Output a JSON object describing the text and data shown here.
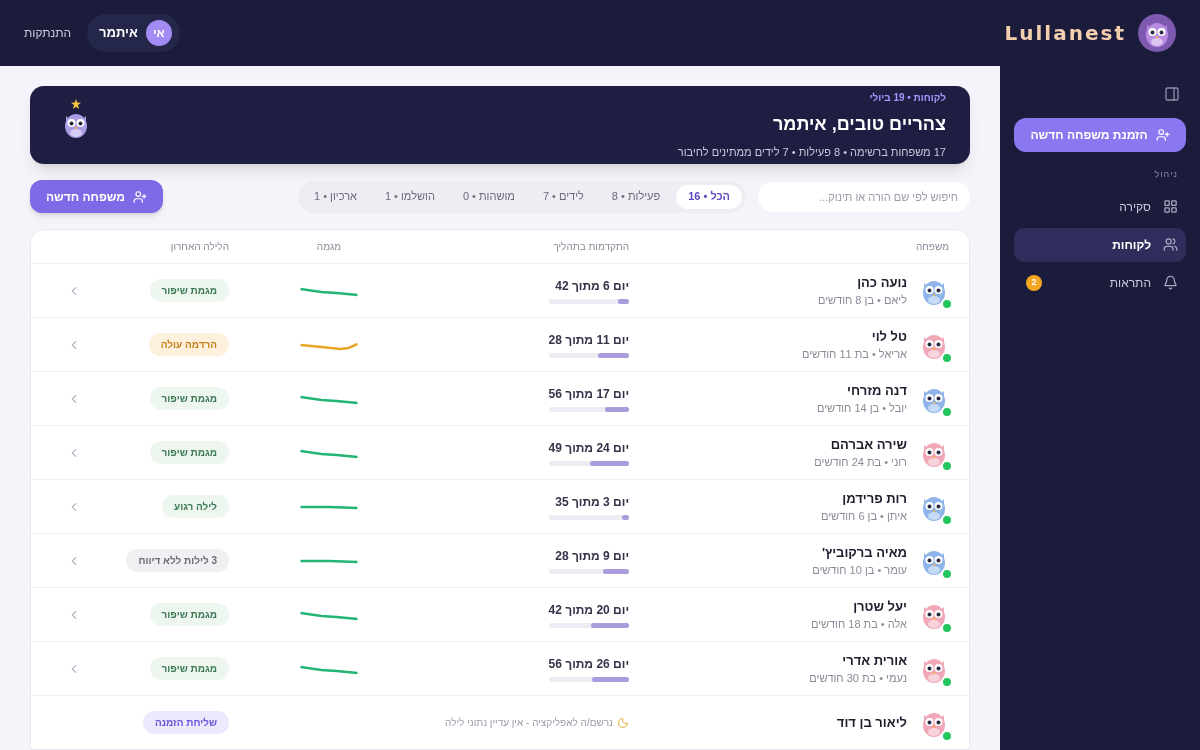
{
  "header": {
    "brand": "Lullanest",
    "user": {
      "initials": "אי",
      "name": "איתמר"
    },
    "logout": "התנתקות"
  },
  "sidebar": {
    "invite_button": "הזמנת משפחה חדשה",
    "section": "ניהול",
    "items": [
      {
        "label": "סקירה",
        "selected": false
      },
      {
        "label": "לקוחות",
        "selected": true
      },
      {
        "label": "התראות",
        "selected": false,
        "badge": "2"
      }
    ]
  },
  "hero": {
    "eyebrow": "לקוחות • 19 ביולי",
    "title": "צהריים טובים, איתמר",
    "subtitle": "17 משפחות ברשימה • 8 פעילות • 7 לידים ממתינים לחיבור"
  },
  "search": {
    "placeholder": "חיפוש לפי שם הורה או תינוק..."
  },
  "tabs": [
    {
      "label": "הכל • 16",
      "selected": true
    },
    {
      "label": "פעילות • 8",
      "selected": false
    },
    {
      "label": "לידים • 7",
      "selected": false
    },
    {
      "label": "מושהות • 0",
      "selected": false
    },
    {
      "label": "הושלמו • 1",
      "selected": false
    },
    {
      "label": "ארכיון • 1",
      "selected": false
    }
  ],
  "new_family_button": "משפחה חדשה",
  "table": {
    "columns": [
      "משפחה",
      "התקדמות בתהליך",
      "מגמה",
      "הלילה האחרון"
    ],
    "rows": [
      {
        "kind": "boy",
        "name": "נועה כהן",
        "child": "ליאם • בן 8 חודשים",
        "progress": "יום 6 מתוך 42",
        "level": 0.14,
        "trend": {
          "kind": "down",
          "color": "#22b573"
        },
        "badge": {
          "kind": "good",
          "label": "מגמת שיפור"
        }
      },
      {
        "kind": "girl",
        "name": "טל לוי",
        "child": "אריאל • בת 11 חודשים",
        "progress": "יום 11 מתוך 28",
        "level": 0.39,
        "trend": {
          "kind": "dip",
          "color": "#e6a623"
        },
        "badge": {
          "kind": "warn",
          "label": "הרדמה עולה"
        }
      },
      {
        "kind": "boy",
        "name": "דנה מזרחי",
        "child": "יובל • בן 14 חודשים",
        "progress": "יום 17 מתוך 56",
        "level": 0.3,
        "trend": {
          "kind": "down",
          "color": "#22b573"
        },
        "badge": {
          "kind": "good",
          "label": "מגמת שיפור"
        }
      },
      {
        "kind": "girl",
        "name": "שירה אברהם",
        "child": "רוני • בת 24 חודשים",
        "progress": "יום 24 מתוך 49",
        "level": 0.49,
        "trend": {
          "kind": "down",
          "color": "#22b573"
        },
        "badge": {
          "kind": "good",
          "label": "מגמת שיפור"
        }
      },
      {
        "kind": "boy",
        "name": "רות פרידמן",
        "child": "איתן • בן 6 חודשים",
        "progress": "יום 3 מתוך 35",
        "level": 0.09,
        "trend": {
          "kind": "flat",
          "color": "#22b573"
        },
        "badge": {
          "kind": "good",
          "label": "לילה רגוע"
        }
      },
      {
        "kind": "boy",
        "name": "מאיה ברקוביץ'",
        "child": "עומר • בן 10 חודשים",
        "progress": "יום 9 מתוך 28",
        "level": 0.32,
        "trend": {
          "kind": "flat",
          "color": "#22b573"
        },
        "badge": {
          "kind": "muted",
          "label": "3 לילות ללא דיווח"
        }
      },
      {
        "kind": "girl",
        "name": "יעל שטרן",
        "child": "אלה • בת 18 חודשים",
        "progress": "יום 20 מתוך 42",
        "level": 0.48,
        "trend": {
          "kind": "down",
          "color": "#22b573"
        },
        "badge": {
          "kind": "good",
          "label": "מגמת שיפור"
        }
      },
      {
        "kind": "girl",
        "name": "אורית אדרי",
        "child": "נעמי • בת 30 חודשים",
        "progress": "יום 26 מתוך 56",
        "level": 0.46,
        "trend": {
          "kind": "down",
          "color": "#22b573"
        },
        "badge": {
          "kind": "good",
          "label": "מגמת שיפור"
        }
      },
      {
        "kind": "girl",
        "name": "ליאור בן דוד",
        "note": "נרשם/ה לאפליקציה - אין עדיין נתוני לילה",
        "badge": {
          "kind": "action",
          "label": "שליחת הזמנה"
        }
      }
    ]
  }
}
